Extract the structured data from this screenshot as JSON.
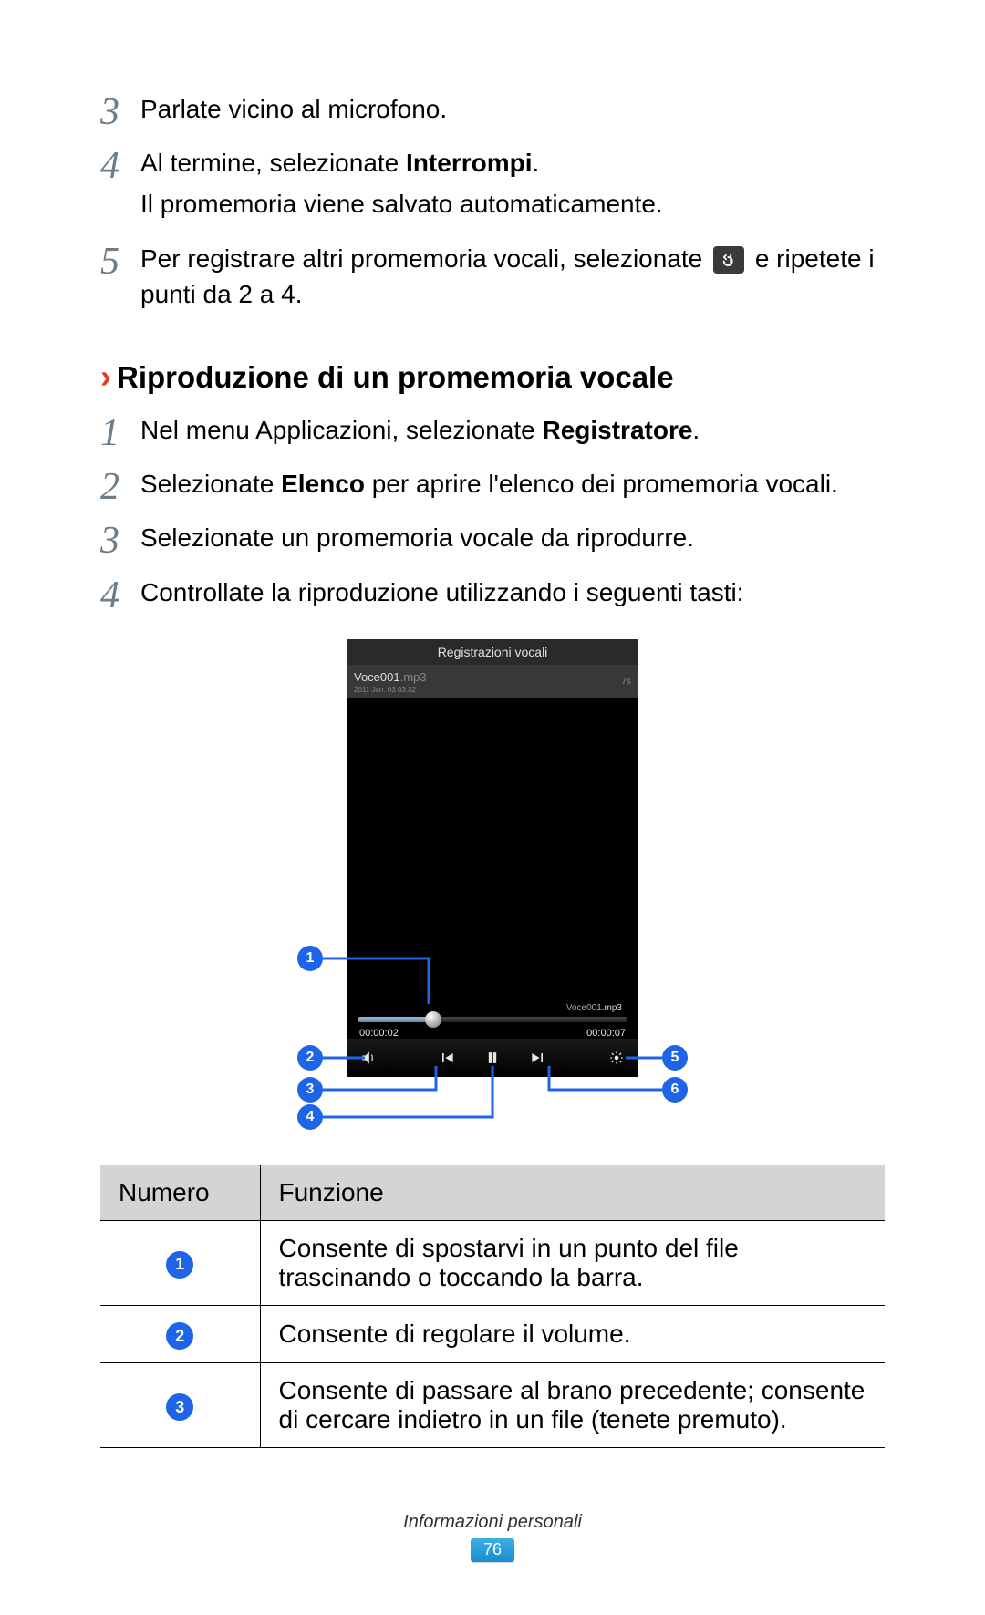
{
  "prev_steps": {
    "s3": {
      "text": "Parlate vicino al microfono."
    },
    "s4": {
      "line1_pre": "Al termine, selezionate ",
      "line1_bold": "Interrompi",
      "line1_post": ".",
      "line2": "Il promemoria viene salvato automaticamente."
    },
    "s5": {
      "pre": "Per registrare altri promemoria vocali, selezionate ",
      "post": " e ripetete i punti da 2 a 4."
    }
  },
  "section": {
    "chevron": "›",
    "title": "Riproduzione di un promemoria vocale"
  },
  "steps": {
    "s1": {
      "pre": "Nel menu Applicazioni, selezionate ",
      "bold": "Registratore",
      "post": "."
    },
    "s2": {
      "pre": "Selezionate ",
      "bold": "Elenco",
      "post": " per aprire l'elenco dei promemoria vocali."
    },
    "s3": {
      "text": "Selezionate un promemoria vocale da riprodurre."
    },
    "s4": {
      "text": "Controllate la riproduzione utilizzando i seguenti tasti:"
    }
  },
  "phone": {
    "header": "Registrazioni vocali",
    "filename": "Voce001",
    "ext": ".mp3",
    "date": "2011 Jan. 03 03:32",
    "duration_badge": "7s",
    "nowplaying_name": "Voce001",
    "nowplaying_ext": ".mp3",
    "time_elapsed": "00:00:02",
    "time_total": "00:00:07"
  },
  "markers": {
    "m1": "1",
    "m2": "2",
    "m3": "3",
    "m4": "4",
    "m5": "5",
    "m6": "6"
  },
  "table": {
    "h1": "Numero",
    "h2": "Funzione",
    "rows": [
      {
        "n": "1",
        "desc": "Consente di spostarvi in un punto del file trascinando o toccando la barra."
      },
      {
        "n": "2",
        "desc": "Consente di regolare il volume."
      },
      {
        "n": "3",
        "desc": "Consente di passare al brano precedente; consente di cercare indietro in un file (tenete premuto)."
      }
    ]
  },
  "footer": {
    "section": "Informazioni personali",
    "page": "76"
  },
  "nums": {
    "n3": "3",
    "n4": "4",
    "n5": "5",
    "sn1": "1",
    "sn2": "2",
    "sn3": "3",
    "sn4": "4"
  }
}
